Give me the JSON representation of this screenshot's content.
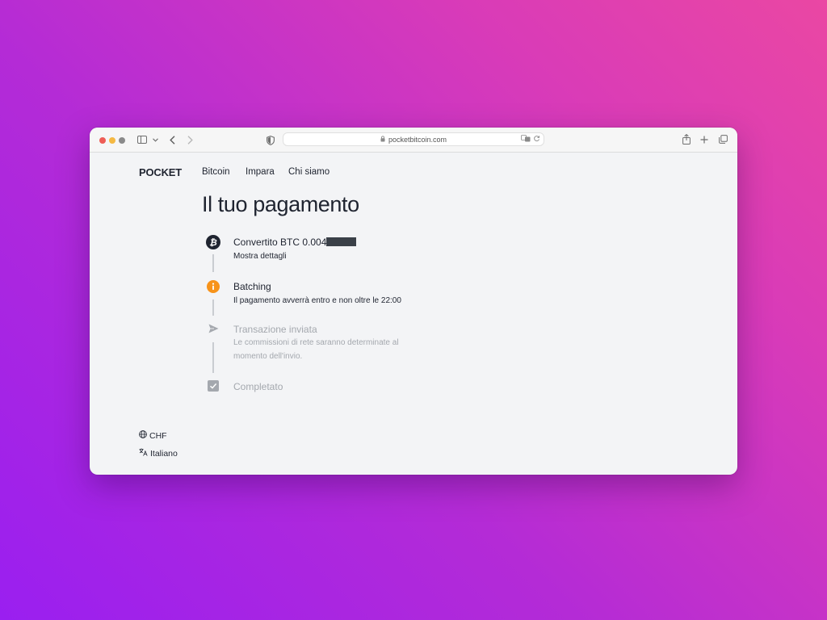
{
  "browser": {
    "url": "pocketbitcoin.com"
  },
  "header": {
    "logo": "POCKET",
    "nav": [
      {
        "label": "Bitcoin"
      },
      {
        "label": "Impara"
      },
      {
        "label": "Chi siamo"
      }
    ]
  },
  "main": {
    "title": "Il tuo pagamento",
    "steps": [
      {
        "title": "Convertito BTC 0.004",
        "desc": "Mostra dettagli",
        "icon": "bitcoin-icon",
        "state": "done"
      },
      {
        "title": "Batching",
        "desc": "Il pagamento avverrà entro e non oltre le 22:00",
        "icon": "info-icon",
        "state": "active",
        "accent": "#f7931a"
      },
      {
        "title": "Transazione inviata",
        "desc_line1": "Le commissioni di rete saranno determinate al",
        "desc_line2": "momento dell'invio.",
        "icon": "paper-plane-icon",
        "state": "pending"
      },
      {
        "title": "Completato",
        "icon": "check-square-icon",
        "state": "pending"
      }
    ]
  },
  "footer": {
    "currency": "CHF",
    "language": "Italiano"
  },
  "colors": {
    "text": "#1f2430",
    "muted": "#a4a8ae",
    "accent": "#f7931a"
  }
}
